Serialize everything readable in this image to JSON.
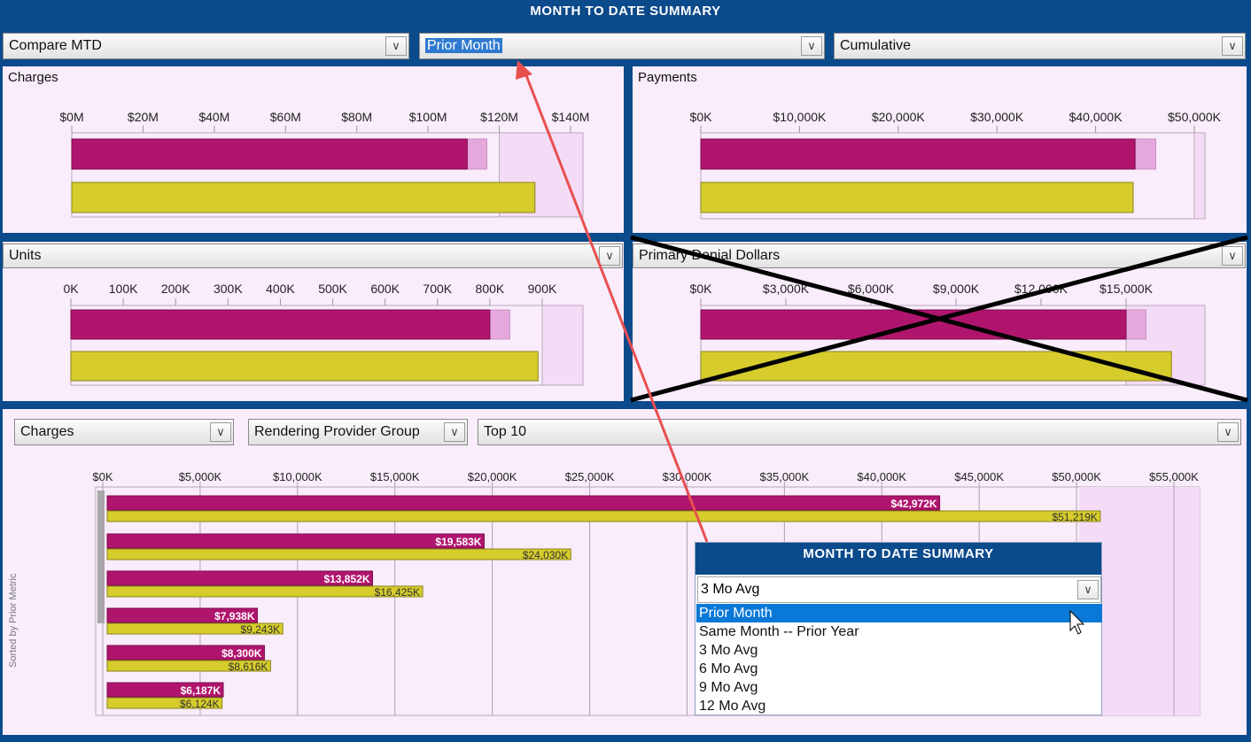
{
  "header": {
    "title": "MONTH TO DATE SUMMARY"
  },
  "top_selectors": {
    "compare": "Compare MTD",
    "period": "Prior Month",
    "mode": "Cumulative"
  },
  "panels": {
    "charges": {
      "title": "Charges",
      "ticks": [
        "$0M",
        "$20M",
        "$40M",
        "$60M",
        "$80M",
        "$100M",
        "$120M",
        "$140M"
      ],
      "axis_max": 140,
      "current": 111,
      "current_projection": 116.5,
      "prior": 130,
      "range_shade_from": 120
    },
    "payments": {
      "title": "Payments",
      "ticks": [
        "$0K",
        "$10,000K",
        "$20,000K",
        "$30,000K",
        "$40,000K",
        "$50,000K"
      ],
      "axis_max": 50000,
      "current": 44000,
      "current_projection": 46100,
      "prior": 43800,
      "range_shade_from": 50000
    },
    "units": {
      "title": "Units",
      "ticks": [
        "0K",
        "100K",
        "200K",
        "300K",
        "400K",
        "500K",
        "600K",
        "700K",
        "800K",
        "900K"
      ],
      "axis_max": 900,
      "current": 800,
      "current_projection": 838,
      "prior": 892,
      "range_shade_from": 900
    },
    "denials": {
      "title": "Primary Denial Dollars",
      "ticks": [
        "$0K",
        "$3,000K",
        "$6,000K",
        "$9,000K",
        "$12,000K",
        "$15,000K"
      ],
      "axis_max": 15000,
      "current": 15000,
      "current_projection": 15700,
      "prior": 16600,
      "range_shade_from": 15000
    }
  },
  "bottom": {
    "metric": "Charges",
    "grouping": "Rendering Provider Group",
    "topn": "Top 10",
    "side_label": "Sorted by Prior Metric"
  },
  "chart_data": {
    "type": "bar",
    "orientation": "horizontal",
    "xlim": [
      0,
      55000
    ],
    "ticks": [
      "$0K",
      "$5,000K",
      "$10,000K",
      "$15,000K",
      "$20,000K",
      "$25,000K",
      "$30,000K",
      "$35,000K",
      "$40,000K",
      "$45,000K",
      "$50,000K",
      "$55,000K"
    ],
    "series": [
      {
        "values": [
          42972,
          19583,
          13852,
          7938,
          8300,
          6187
        ],
        "labels": [
          "$42,972K",
          "$19,583K",
          "$13,852K",
          "$7,938K",
          "$8,300K",
          "$6,187K"
        ]
      },
      {
        "values": [
          51219,
          24030,
          16425,
          9243,
          8616,
          6124
        ],
        "labels": [
          "$51,219K",
          "$24,030K",
          "$16,425K",
          "$9,243K",
          "$8,616K",
          "$6,124K"
        ]
      }
    ]
  },
  "popup": {
    "title": "MONTH TO DATE SUMMARY",
    "selected": "3 Mo Avg",
    "options": [
      "Prior Month",
      "Same Month -- Prior Year",
      "3 Mo Avg",
      "6 Mo Avg",
      "9 Mo Avg",
      "12 Mo Avg"
    ]
  },
  "colors": {
    "current": "#b0156e",
    "prior": "#d6cc2c",
    "panel_bg": "#f9ecfb",
    "frame": "#0b4a8b",
    "arrow": "#e85050"
  }
}
